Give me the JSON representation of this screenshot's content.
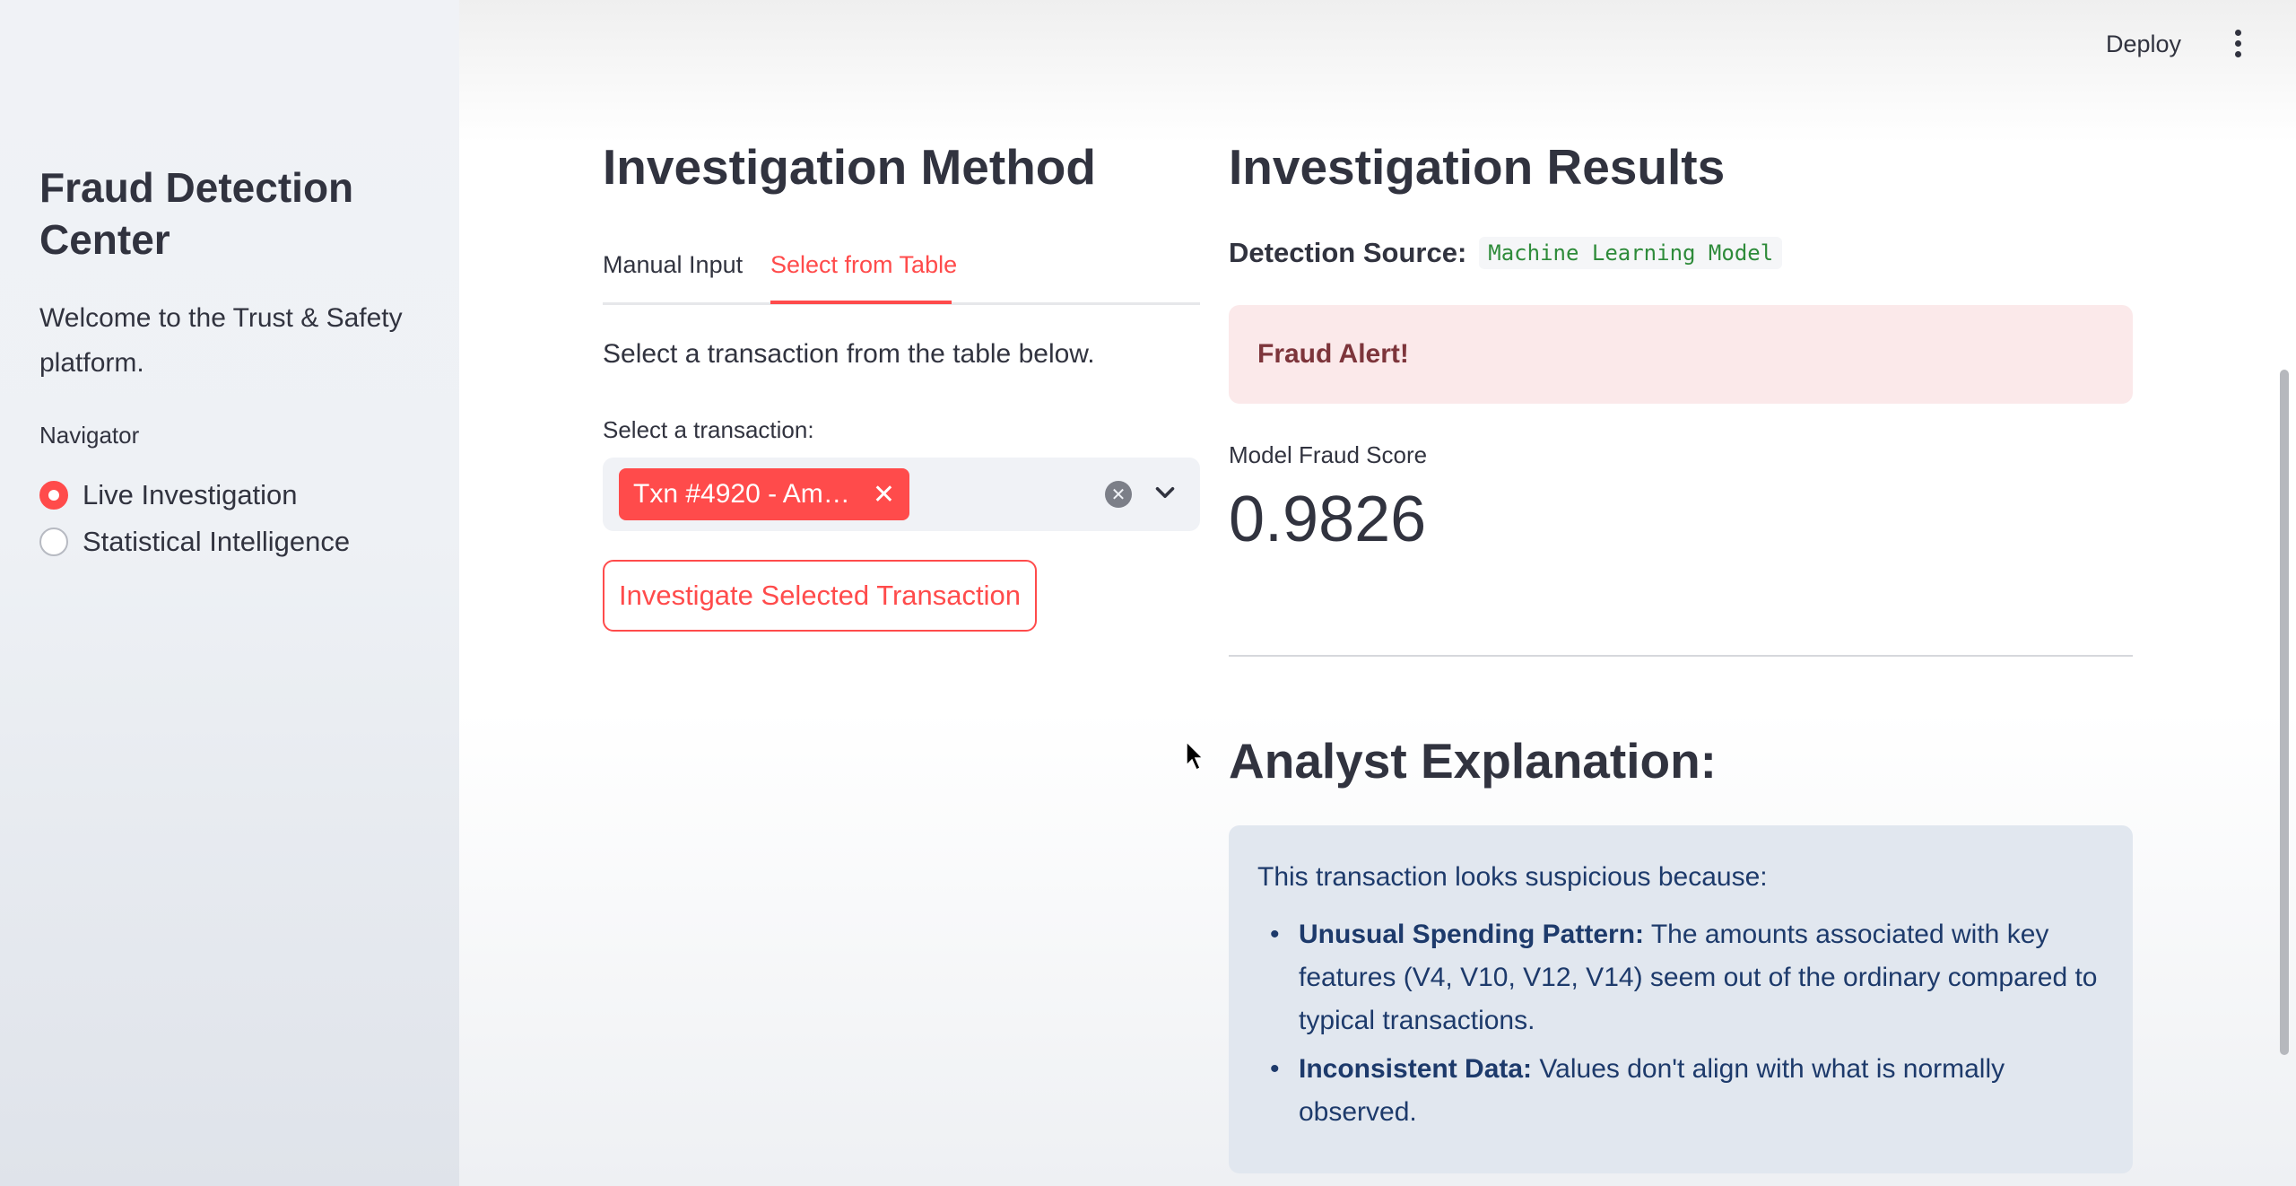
{
  "sidebar": {
    "title": "Fraud Detection Center",
    "welcome": "Welcome to the Trust & Safety platform.",
    "nav_label": "Navigator",
    "items": [
      {
        "label": "Live Investigation",
        "selected": true
      },
      {
        "label": "Statistical Intelligence",
        "selected": false
      }
    ]
  },
  "header": {
    "deploy_label": "Deploy",
    "menu_icon": "more-vertical-icon"
  },
  "left": {
    "title": "Investigation Method",
    "tabs": [
      {
        "label": "Manual Input",
        "active": false
      },
      {
        "label": "Select from Table",
        "active": true
      }
    ],
    "instruction": "Select a transaction from the table below.",
    "select_label": "Select a transaction:",
    "selected_chip": "Txn #4920 - Amo…",
    "button_label": "Investigate Selected Transaction"
  },
  "right": {
    "title": "Investigation Results",
    "detection_label": "Detection Source:",
    "detection_value": "Machine Learning Model",
    "alert": "Fraud Alert!",
    "metric_label": "Model Fraud Score",
    "metric_value": "0.9826",
    "explanation_title": "Analyst Explanation:",
    "explanation_intro": "This transaction looks suspicious because:",
    "reasons": [
      {
        "title": "Unusual Spending Pattern:",
        "text": " The amounts associated with key features (V4, V10, V12, V14) seem out of the ordinary compared to typical transactions."
      },
      {
        "title": "Inconsistent Data:",
        "text": " Values don't align with what is normally observed."
      }
    ]
  },
  "colors": {
    "accent": "#ff4b4b",
    "alert_bg": "#fbe9ea",
    "info_bg": "#e1e7ef",
    "info_text": "#1d3a6b"
  }
}
